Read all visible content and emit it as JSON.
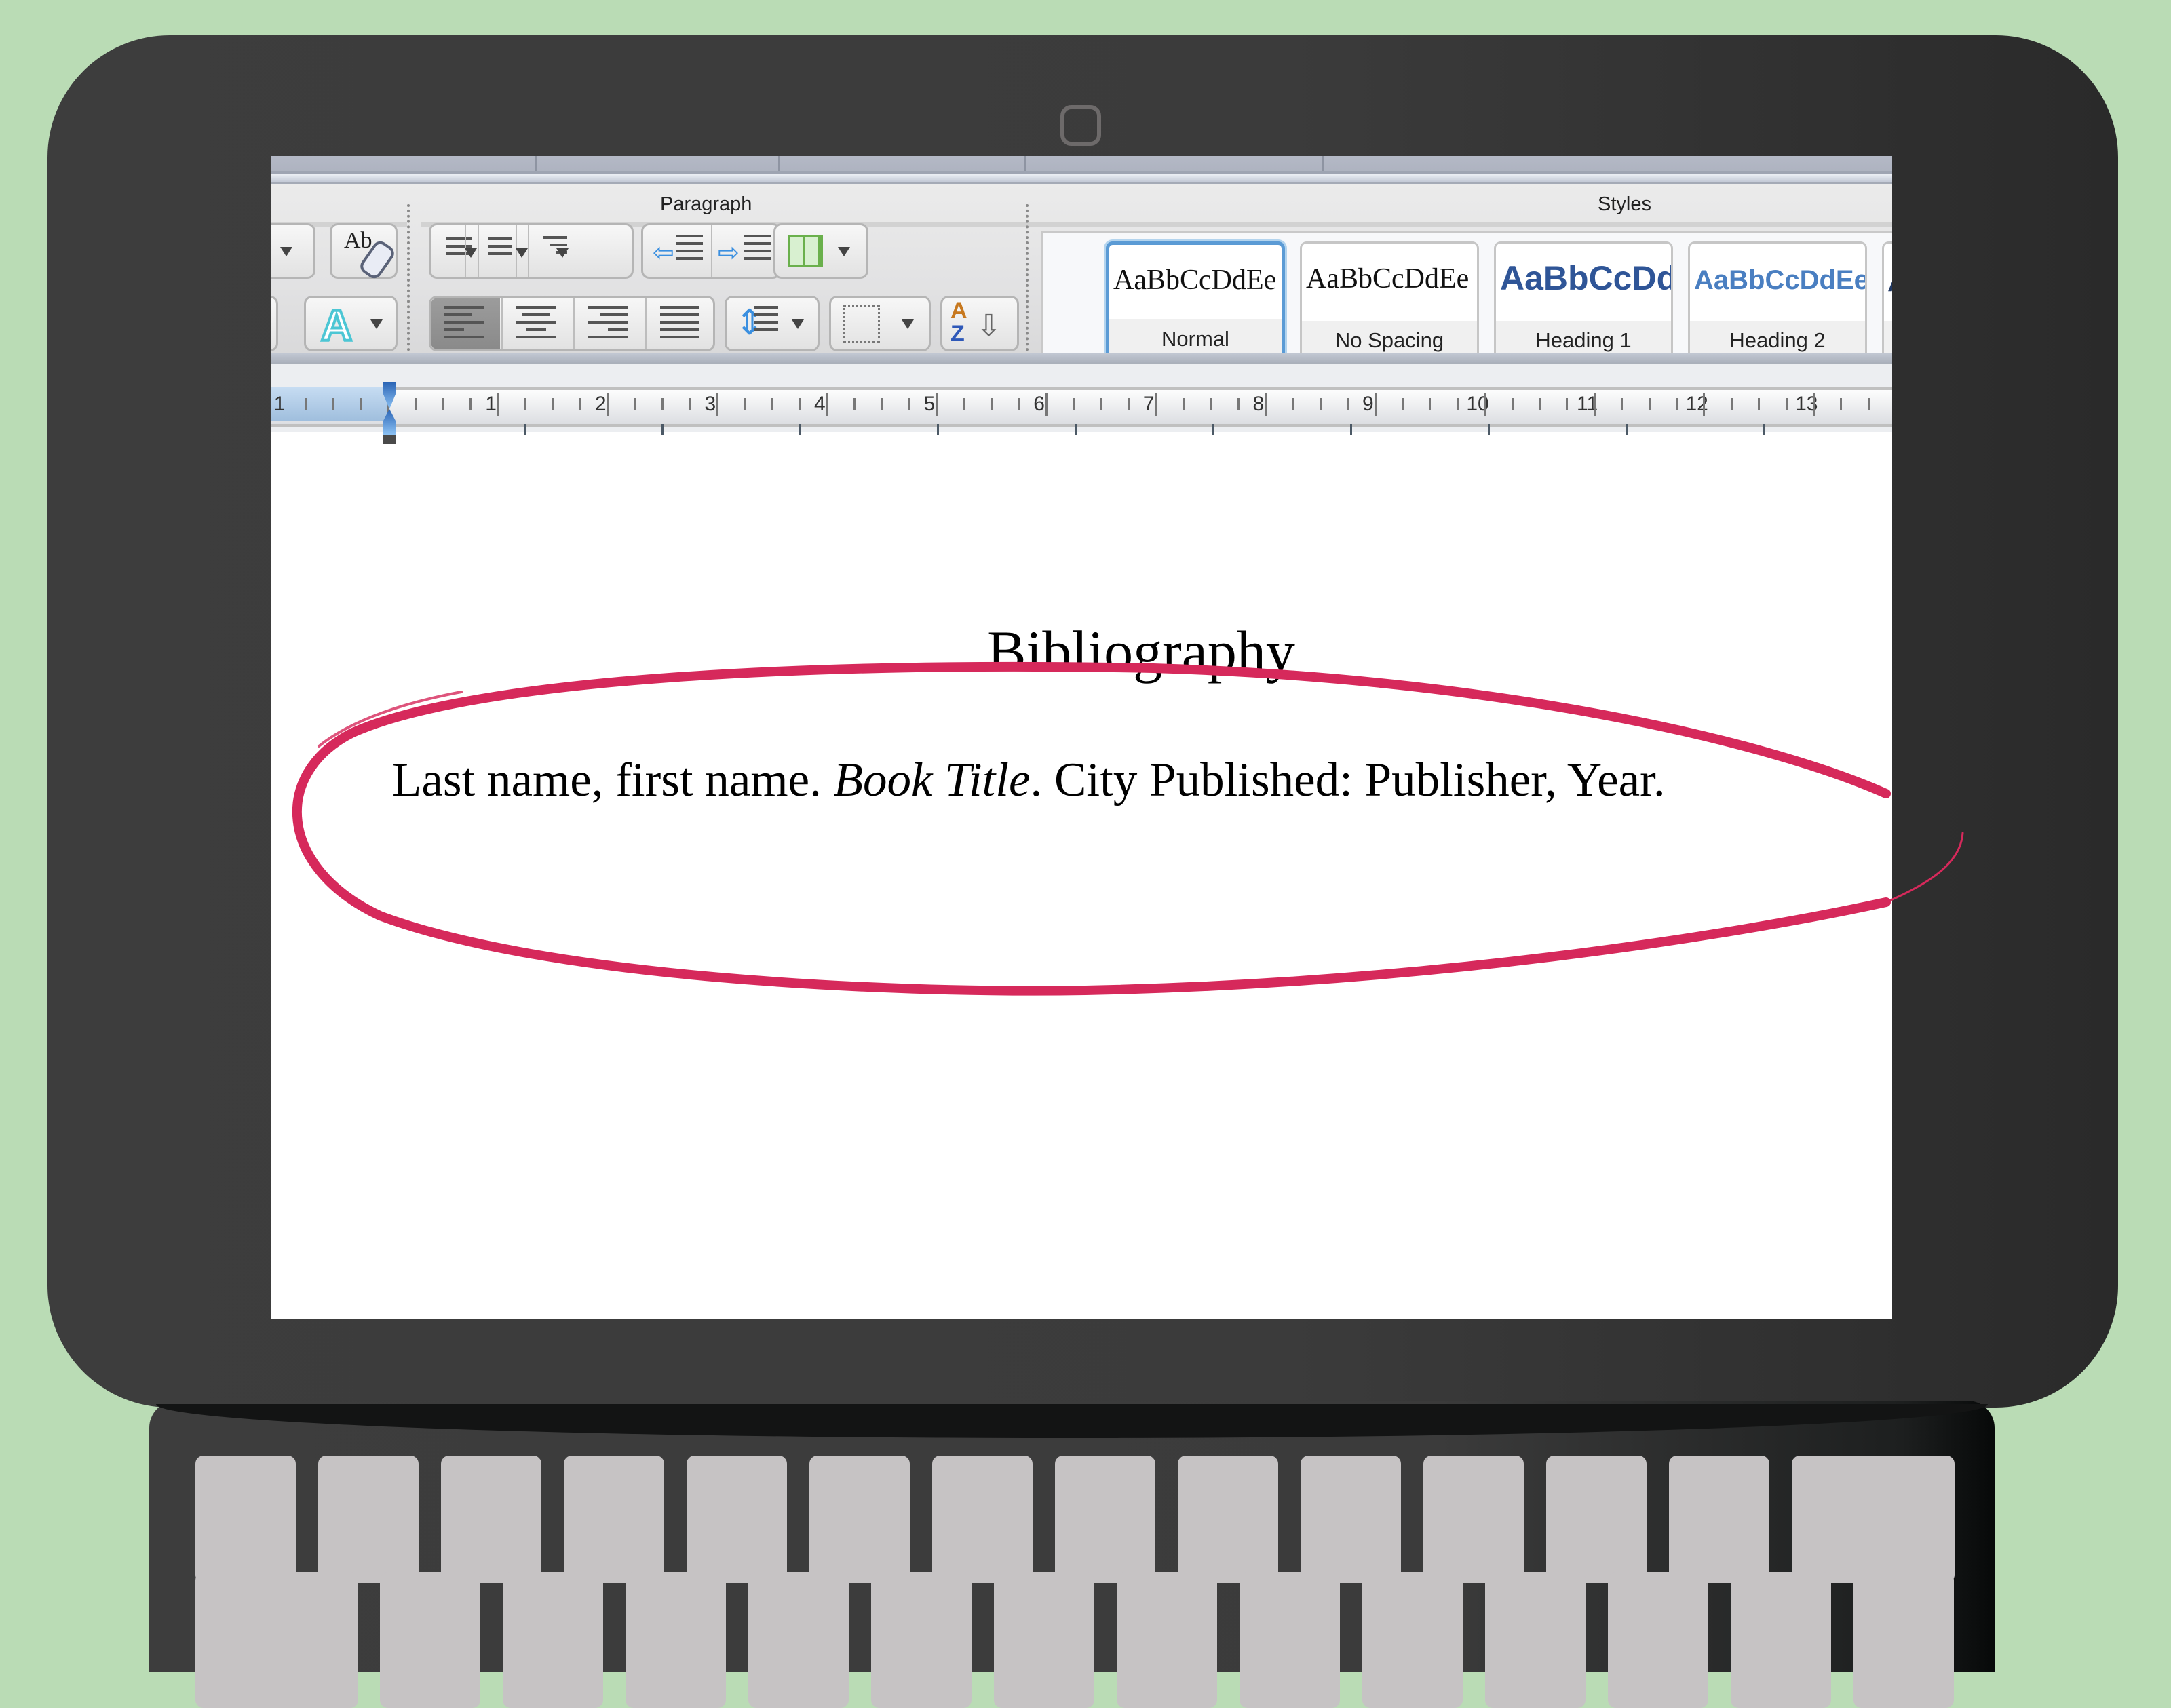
{
  "ribbon": {
    "groups": {
      "paragraph": "Paragraph",
      "styles": "Styles"
    },
    "icons": {
      "clear_formatting": "Ab",
      "text_effects": "A",
      "sort_top": "A",
      "sort_bottom": "Z"
    },
    "styles_gallery": [
      {
        "sample": "AaBbCcDdEe",
        "name": "Normal",
        "selected": true
      },
      {
        "sample": "AaBbCcDdEe",
        "name": "No Spacing",
        "selected": false
      },
      {
        "sample": "AaBbCcDd",
        "name": "Heading 1",
        "selected": false
      },
      {
        "sample": "AaBbCcDdEe",
        "name": "Heading 2",
        "selected": false
      },
      {
        "sample": "A",
        "name": "",
        "selected": false
      }
    ]
  },
  "ruler": {
    "numbers": [
      "1",
      "1",
      "2",
      "3",
      "4",
      "5",
      "6",
      "7",
      "8",
      "9",
      "10",
      "11",
      "12",
      "13"
    ]
  },
  "document": {
    "title": "Bibliography",
    "entry": {
      "before": "Last name, first name. ",
      "italic": "Book Title",
      "after": ". City Published: Publisher, Year."
    }
  },
  "annotation": {
    "shape": "hand-drawn ellipse",
    "color": "#d6295b",
    "target": "bibliography entry"
  },
  "colors": {
    "background": "#badcb5",
    "laptop_body": "#3d3d3d",
    "keys": "#c6c3c4",
    "style_heading": "#2f5597",
    "style_heading2": "#4a7fc1",
    "selected_style_border": "#5b9bd5"
  }
}
